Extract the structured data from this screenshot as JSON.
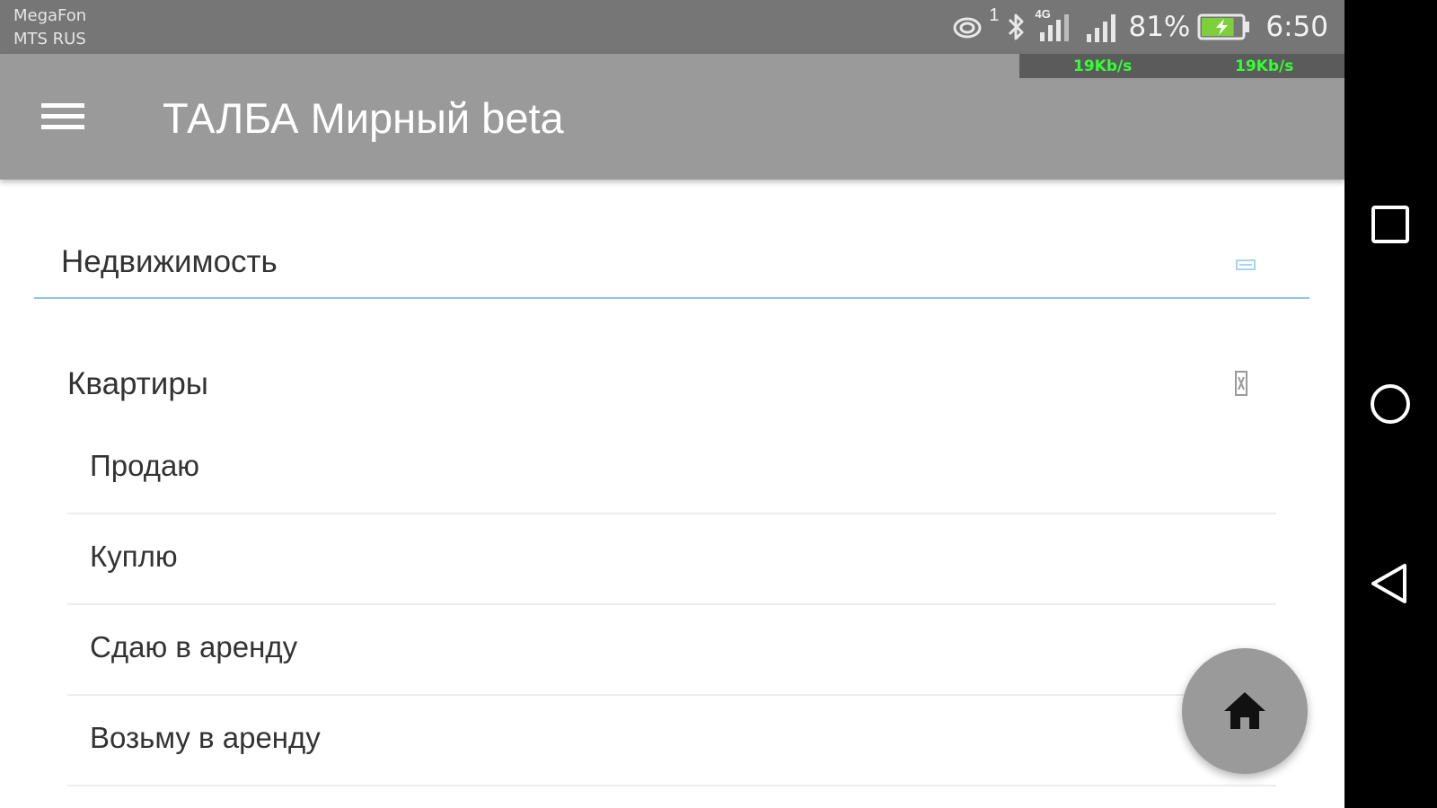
{
  "status_bar": {
    "carrier_1": "MegaFon",
    "carrier_2": "MTS RUS",
    "sync_badge": "1",
    "network_type": "4G",
    "battery_percent": "81%",
    "battery_level": 0.81,
    "time": "6:50",
    "speed_1": "19Kb/s",
    "speed_2": "19Kb/s",
    "icons": [
      "sync-icon",
      "bluetooth-icon",
      "signal-4g-icon",
      "signal-icon",
      "battery-charging-icon"
    ]
  },
  "app_bar": {
    "menu_icon": "hamburger-menu-icon",
    "title": "ТАЛБА Мирный beta"
  },
  "category_select": {
    "value": "Недвижимость",
    "icon": "dropdown-arrow-icon"
  },
  "subcategory": {
    "label": "Квартиры",
    "icon": "expand-collapse-icon"
  },
  "options": [
    {
      "label": "Продаю"
    },
    {
      "label": "Куплю"
    },
    {
      "label": "Сдаю в аренду"
    },
    {
      "label": "Возьму в аренду"
    }
  ],
  "fab": {
    "icon": "home-icon"
  },
  "nav_bar": {
    "icons": [
      "recents-square-icon",
      "home-circle-icon",
      "back-triangle-icon"
    ]
  },
  "colors": {
    "status_bar": "#767676",
    "app_bar": "#9a9a9a",
    "accent_underline": "#8ec5ea",
    "nav_bar": "#000000",
    "speed_text": "#33ff33",
    "battery_fill": "#7ed03b"
  }
}
